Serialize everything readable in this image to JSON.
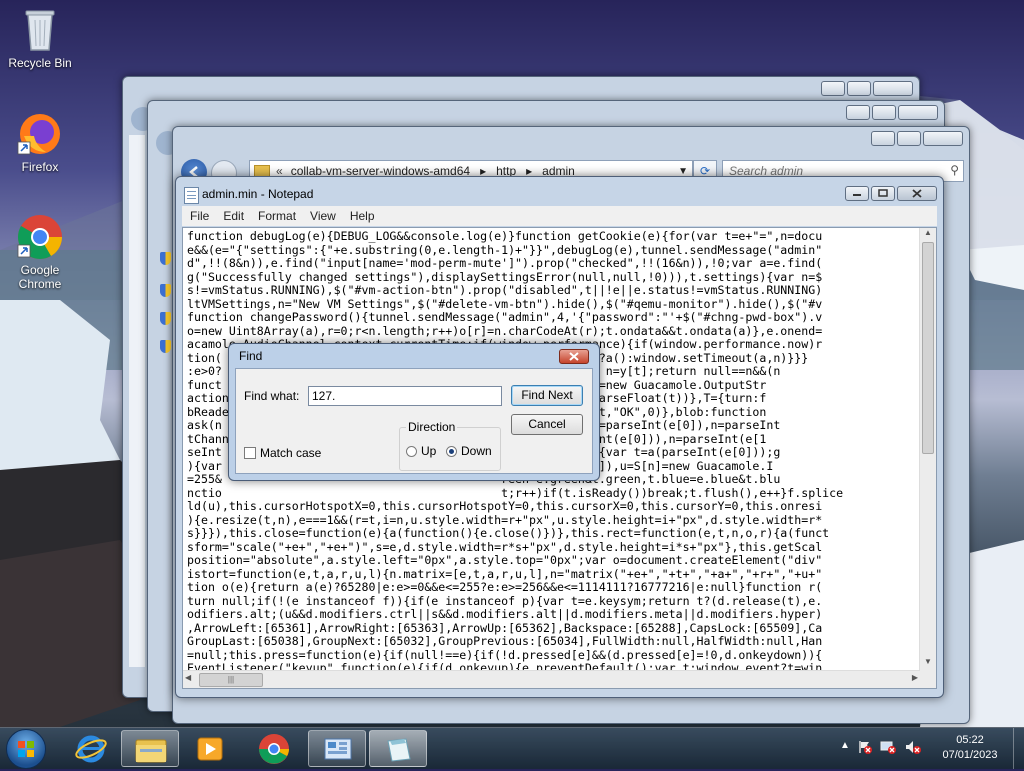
{
  "desktop": {
    "icons": [
      {
        "label": "Recycle Bin"
      },
      {
        "label": "Firefox"
      },
      {
        "label": "Google Chrome"
      }
    ]
  },
  "explorer": {
    "breadcrumb": [
      "collab-vm-server-windows-amd64",
      "http",
      "admin"
    ],
    "search_placeholder": "Search admin"
  },
  "notepad": {
    "title": "admin.min - Notepad",
    "menu": [
      "File",
      "Edit",
      "Format",
      "View",
      "Help"
    ],
    "lines": [
      "function debugLog(e){DEBUG_LOG&&console.log(e)}function getCookie(e){for(var t=e+\"=\",n=docu",
      "e&&(e=\"{\"settings\":{\"+e.substring(0,e.length-1)+\"}}\",debugLog(e),tunnel.sendMessage(\"admin\"",
      "d\",!!(8&n)),e.find(\"input[name='mod-perm-mute']\").prop(\"checked\",!!(16&n)),!0;var a=e.find(",
      "g(\"Successfully changed settings\"),displaySettingsError(null,null,!0))),t.settings){var n=$",
      "s!=vmStatus.RUNNING),$(\"#vm-action-btn\").prop(\"disabled\",t||!e||e.status!=vmStatus.RUNNING)",
      "ltVMSettings,n=\"New VM Settings\",$(\"#delete-vm-btn\").hide(),$(\"#qemu-monitor\").hide(),$(\"#v",
      "function changePassword(){tunnel.sendMessage(\"admin\",4,'{\"password\":\"'+$(\"#chng-pwd-box\").v",
      "o=new Uint8Array(a),r=0;r<n.length;r++)o[r]=n.charCodeAt(r);t.ondata&&t.ondata(a)},e.onend=",
      "acamole.AudioChannel.context.currentTime;if(window.performance){if(window.performance.now)r",
      "tion(                                             n=e-t;n<0?a():window.setTimeout(a,n)}}}",
      ":e>0?                                        ction o(t){var n=y[t];return null==n&&(n",
      "funct                                        ,n);var o=I[a]=new Guacamole.OutputStr",
      "action                                       MiterLimit(e,parseFloat(t))},T={turn:f",
      "bReade                                       0)),i.sendAck(t,\"OK\",0)},blob:function",
      "ask(n                                        ction(e){var t=parseInt(e[0]),n=parseInt",
      "tChann                                       var a=t(parseInt(e[0])),n=parseInt(e[1",
      "seInt                                        et:function(e){var t=a(parseInt(e[0]));g",
      "){var                                        parseFloat(t[3]),u=S[n]=new Guacamole.I",
      "=255&                                        reen=e.green&t.green,t.blue=e.blue&t.blu",
      "nctio                                        t;r++)if(t.isReady())break;t.flush(),e++}f.splice",
      "ld(u),this.cursorHotspotX=0,this.cursorHotspotY=0,this.cursorX=0,this.cursorY=0,this.onresi",
      "){e.resize(t,n),e===1&&(r=t,i=n,u.style.width=r+\"px\",u.style.height=i+\"px\",d.style.width=r*",
      "s}}}),this.close=function(e){a(function(){e.close()})},this.rect=function(e,t,n,o,r){a(funct",
      "sform=\"scale(\"+e+\",\"+e+\")\",s=e,d.style.width=r*s+\"px\",d.style.height=i*s+\"px\"},this.getScal",
      "position=\"absolute\",a.style.left=\"0px\",a.style.top=\"0px\";var o=document.createElement(\"div\"",
      "istort=function(e,t,a,r,u,l){n.matrix=[e,t,a,r,u,l],n=\"matrix(\"+e+\",\"+t+\",\"+a+\",\"+r+\",\"+u+\"",
      "tion o(e){return a(e)?65280|e:e>=0&&e<=255?e:e>=256&&e<=1114111?16777216|e:null}function r(",
      "turn null;if(!(e instanceof f)){if(e instanceof p){var t=e.keysym;return t?(d.release(t),e.",
      "odifiers.alt;(u&&d.modifiers.ctrl||s&&d.modifiers.alt||d.modifiers.meta||d.modifiers.hyper)",
      ",ArrowLeft:[65361],ArrowRight:[65363],ArrowUp:[65362],Backspace:[65288],CapsLock:[65509],Ca",
      "GroupLast:[65038],GroupNext:[65032],GroupPrevious:[65034],FullWidth:null,HalfWidth:null,Han",
      "=null;this.press=function(e){if(null!==e){if(!d.pressed[e]&&(d.pressed[e]=!0,d.onkeydown)){",
      "EventListener(\"keyup\",function(e){if(d.onkeyup){e.preventDefault();var t;window.event?t=win",
      "positeOperation=s,o.width=e,o.height=t,u=0,i.save()}function a(e,t,n,a){var r,i=n+e,s=a+t;r"
    ]
  },
  "find_dialog": {
    "title": "Find",
    "find_what_label": "Find what:",
    "find_what_value": "127.",
    "find_next_label": "Find Next",
    "cancel_label": "Cancel",
    "direction_label": "Direction",
    "up_label": "Up",
    "down_label": "Down",
    "match_case_label": "Match case",
    "direction_selected": "Down",
    "match_case_checked": false
  },
  "tray": {
    "time": "05:22",
    "date": "07/01/2023"
  }
}
